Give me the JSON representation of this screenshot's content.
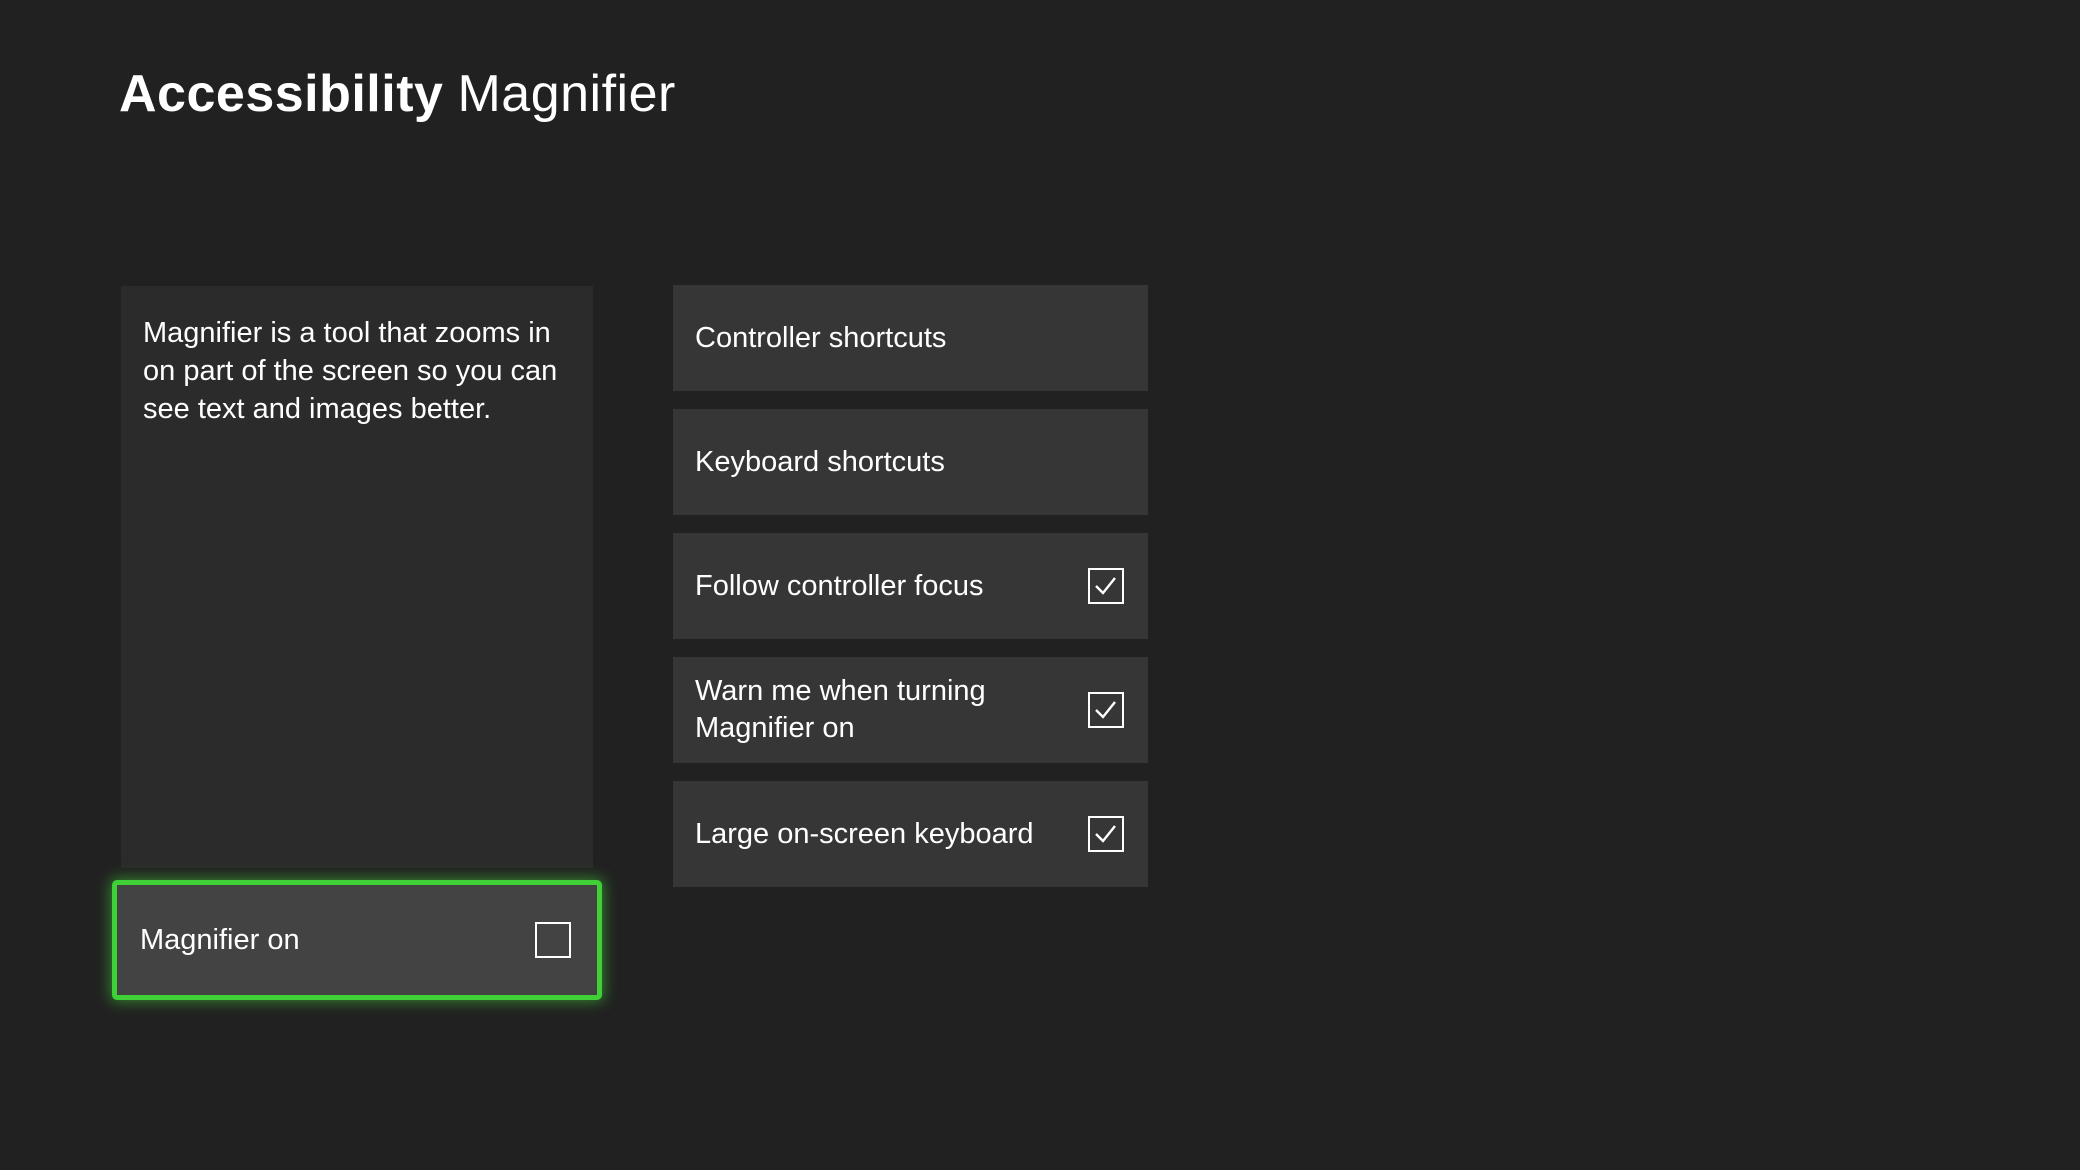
{
  "header": {
    "section": "Accessibility",
    "subsection": "Magnifier"
  },
  "description": {
    "text": "Magnifier is a tool that zooms in on part of the screen so you can see text and images better."
  },
  "magnifier_toggle": {
    "label": "Magnifier on",
    "checked": false
  },
  "options": [
    {
      "label": "Controller shortcuts"
    },
    {
      "label": "Keyboard shortcuts"
    },
    {
      "label": "Follow controller focus",
      "checked": true
    },
    {
      "label": "Warn me when turning Magnifier on",
      "checked": true
    },
    {
      "label": "Large on-screen keyboard",
      "checked": true
    }
  ],
  "colors": {
    "background": "#212121",
    "tile": "#363636",
    "description_panel": "#2b2b2b",
    "focused_tile": "#434343",
    "focus_accent": "#3fcf36",
    "text": "#ffffff"
  },
  "icons": {
    "checkbox_checked": "checkmark-icon",
    "checkbox_unchecked": "empty-checkbox-icon"
  }
}
